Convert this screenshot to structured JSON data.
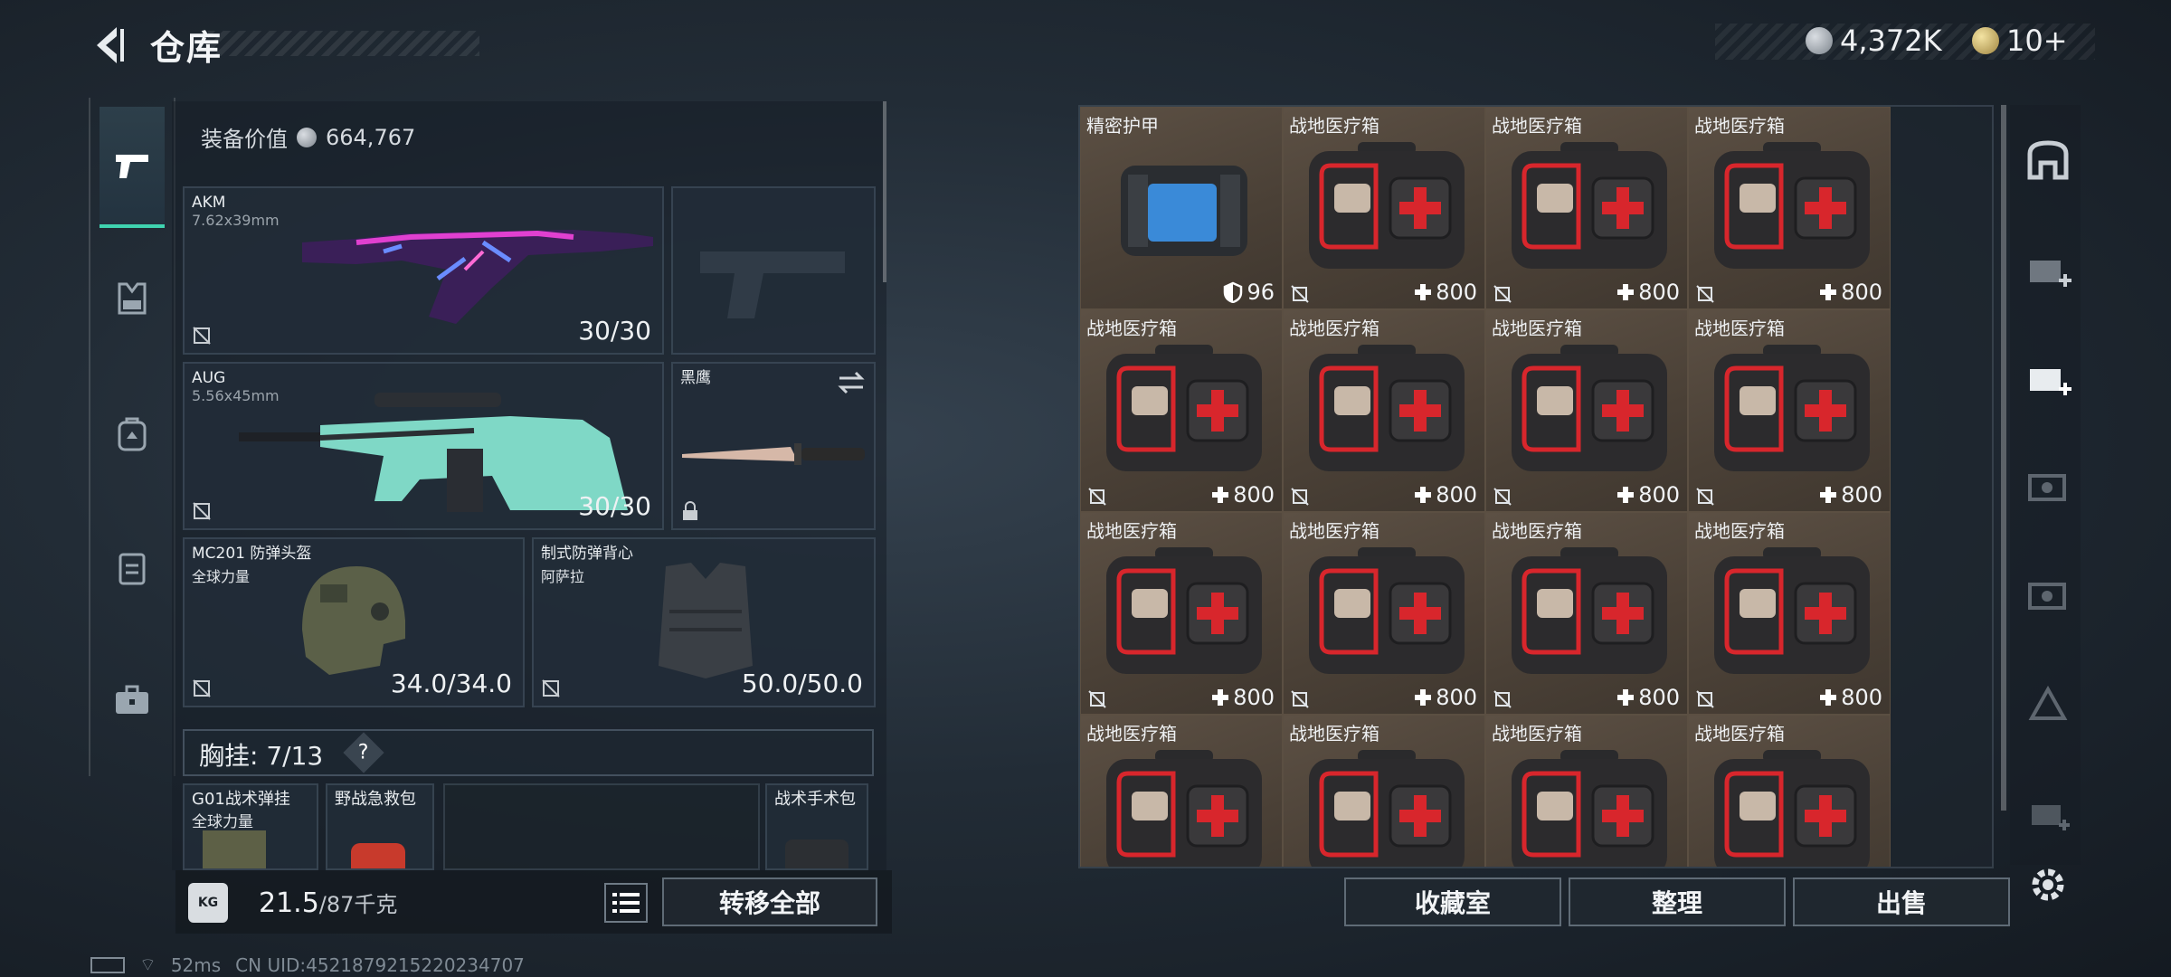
{
  "header": {
    "title": "仓库"
  },
  "currency": {
    "coins": "4,372K",
    "tickets": "10+"
  },
  "equipment": {
    "value_label": "装备价值",
    "value": "664,767",
    "primary": {
      "name": "AKM",
      "ammo_type": "7.62x39mm",
      "count": "30/30"
    },
    "secondary": {
      "name": "AUG",
      "ammo_type": "5.56x45mm",
      "count": "30/30"
    },
    "melee": {
      "name": "黑鹰"
    },
    "helmet": {
      "name": "MC201 防弹头盔",
      "sub": "全球力量",
      "durability": "34.0/34.0"
    },
    "armor": {
      "name": "制式防弹背心",
      "sub": "阿萨拉",
      "durability": "50.0/50.0"
    },
    "chest_rig": {
      "label": "胸挂:",
      "value": "7/13",
      "help": "?"
    },
    "rig_items": [
      {
        "name": "G01战术弹挂",
        "sub": "全球力量"
      },
      {
        "name": "野战急救包"
      },
      {
        "name": "战术手术包"
      }
    ]
  },
  "weight": {
    "current": "21.5",
    "max": "/87千克",
    "icon_label": "KG"
  },
  "actions": {
    "transfer_all": "转移全部",
    "collection": "收藏室",
    "organize": "整理",
    "sell": "出售"
  },
  "storage": {
    "armor_item": {
      "name": "精密护甲",
      "value": "96"
    },
    "medkit_name": "战地医疗箱",
    "medkit_value": "800",
    "medkit_count": 15
  },
  "status": {
    "ping": "52ms",
    "uid": "CN UID:4521879215220234707"
  },
  "colors": {
    "accent": "#3fd3b0",
    "cell_bg": "#4a4036",
    "medkit_red": "#d8262c"
  },
  "icons": [
    "back-arrow-icon",
    "pistol-icon",
    "vest-icon",
    "backpack-icon",
    "rig-icon",
    "case-icon",
    "shield-icon",
    "plus-icon",
    "no-insure-icon",
    "lock-icon",
    "swap-icon",
    "list-icon",
    "gear-icon"
  ]
}
